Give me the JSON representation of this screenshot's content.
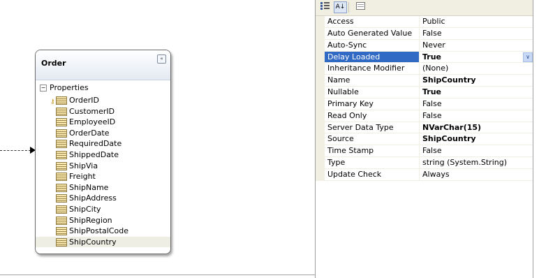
{
  "entity": {
    "title": "Order",
    "collapse_glyph": "«",
    "section": {
      "expander_glyph": "−",
      "label": "Properties"
    },
    "properties": [
      {
        "label": "OrderID",
        "primary_key": true
      },
      {
        "label": "CustomerID"
      },
      {
        "label": "EmployeeID"
      },
      {
        "label": "OrderDate"
      },
      {
        "label": "RequiredDate"
      },
      {
        "label": "ShippedDate"
      },
      {
        "label": "ShipVia"
      },
      {
        "label": "Freight"
      },
      {
        "label": "ShipName"
      },
      {
        "label": "ShipAddress"
      },
      {
        "label": "ShipCity"
      },
      {
        "label": "ShipRegion"
      },
      {
        "label": "ShipPostalCode"
      },
      {
        "label": "ShipCountry",
        "selected": true
      }
    ],
    "key_glyph": "⚷"
  },
  "property_grid": {
    "toolbar": {
      "categorized_icon": "categorized-view-icon",
      "alphabetical_icon": "alphabetical-view-icon",
      "property_pages_icon": "property-pages-icon",
      "alphabetical_glyph": "A↓"
    },
    "rows": [
      {
        "name": "Access",
        "value": "Public"
      },
      {
        "name": "Auto Generated Value",
        "value": "False"
      },
      {
        "name": "Auto-Sync",
        "value": "Never"
      },
      {
        "name": "Delay Loaded",
        "value": "True",
        "bold": true,
        "selected": true
      },
      {
        "name": "Inheritance Modifier",
        "value": "(None)"
      },
      {
        "name": "Name",
        "value": "ShipCountry",
        "bold": true
      },
      {
        "name": "Nullable",
        "value": "True",
        "bold": true
      },
      {
        "name": "Primary Key",
        "value": "False"
      },
      {
        "name": "Read Only",
        "value": "False"
      },
      {
        "name": "Server Data Type",
        "value": "NVarChar(15)",
        "bold": true
      },
      {
        "name": "Source",
        "value": "ShipCountry",
        "bold": true
      },
      {
        "name": "Time Stamp",
        "value": "False"
      },
      {
        "name": "Type",
        "value": "string (System.String)"
      },
      {
        "name": "Update Check",
        "value": "Always"
      }
    ],
    "dropdown_glyph": "∨",
    "selection_color": "#316ac5"
  }
}
